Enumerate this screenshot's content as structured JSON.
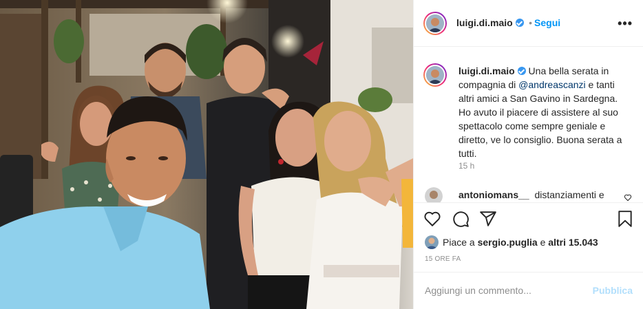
{
  "photo": {
    "alt_subject": "selfie"
  },
  "header": {
    "username": "luigi.di.maio",
    "separator": "•",
    "follow_label": "Segui",
    "more_label": "•••"
  },
  "caption": {
    "username": "luigi.di.maio",
    "text_before": " Una bella serata in compagnia di ",
    "mention": "@andreascanzi",
    "text_after": " e tanti altri amici a San Gavino in Sardegna. Ho avuto il piacere di assistere al suo spettacolo come sempre geniale e diretto, ve lo consiglio. Buona serata a tutti.",
    "time": "15 h"
  },
  "comment": {
    "username": "antoniomans__",
    "text": "distanziamenti e"
  },
  "actions": {
    "like_icon": "heart-icon",
    "comment_icon": "comment-icon",
    "share_icon": "share-icon",
    "save_icon": "bookmark-icon"
  },
  "likes": {
    "prefix": "Piace a ",
    "user": "sergio.puglia",
    "middle": " e ",
    "others": "altri 15.043"
  },
  "timestamp": "15 ORE FA",
  "add_comment": {
    "placeholder": "Aggiungi un commento...",
    "publish_label": "Pubblica"
  },
  "colors": {
    "accent": "#0095f6",
    "publish_disabled": "#b2dffc",
    "text": "#262626",
    "muted": "#8e8e8e",
    "verified": "#3897f0"
  }
}
